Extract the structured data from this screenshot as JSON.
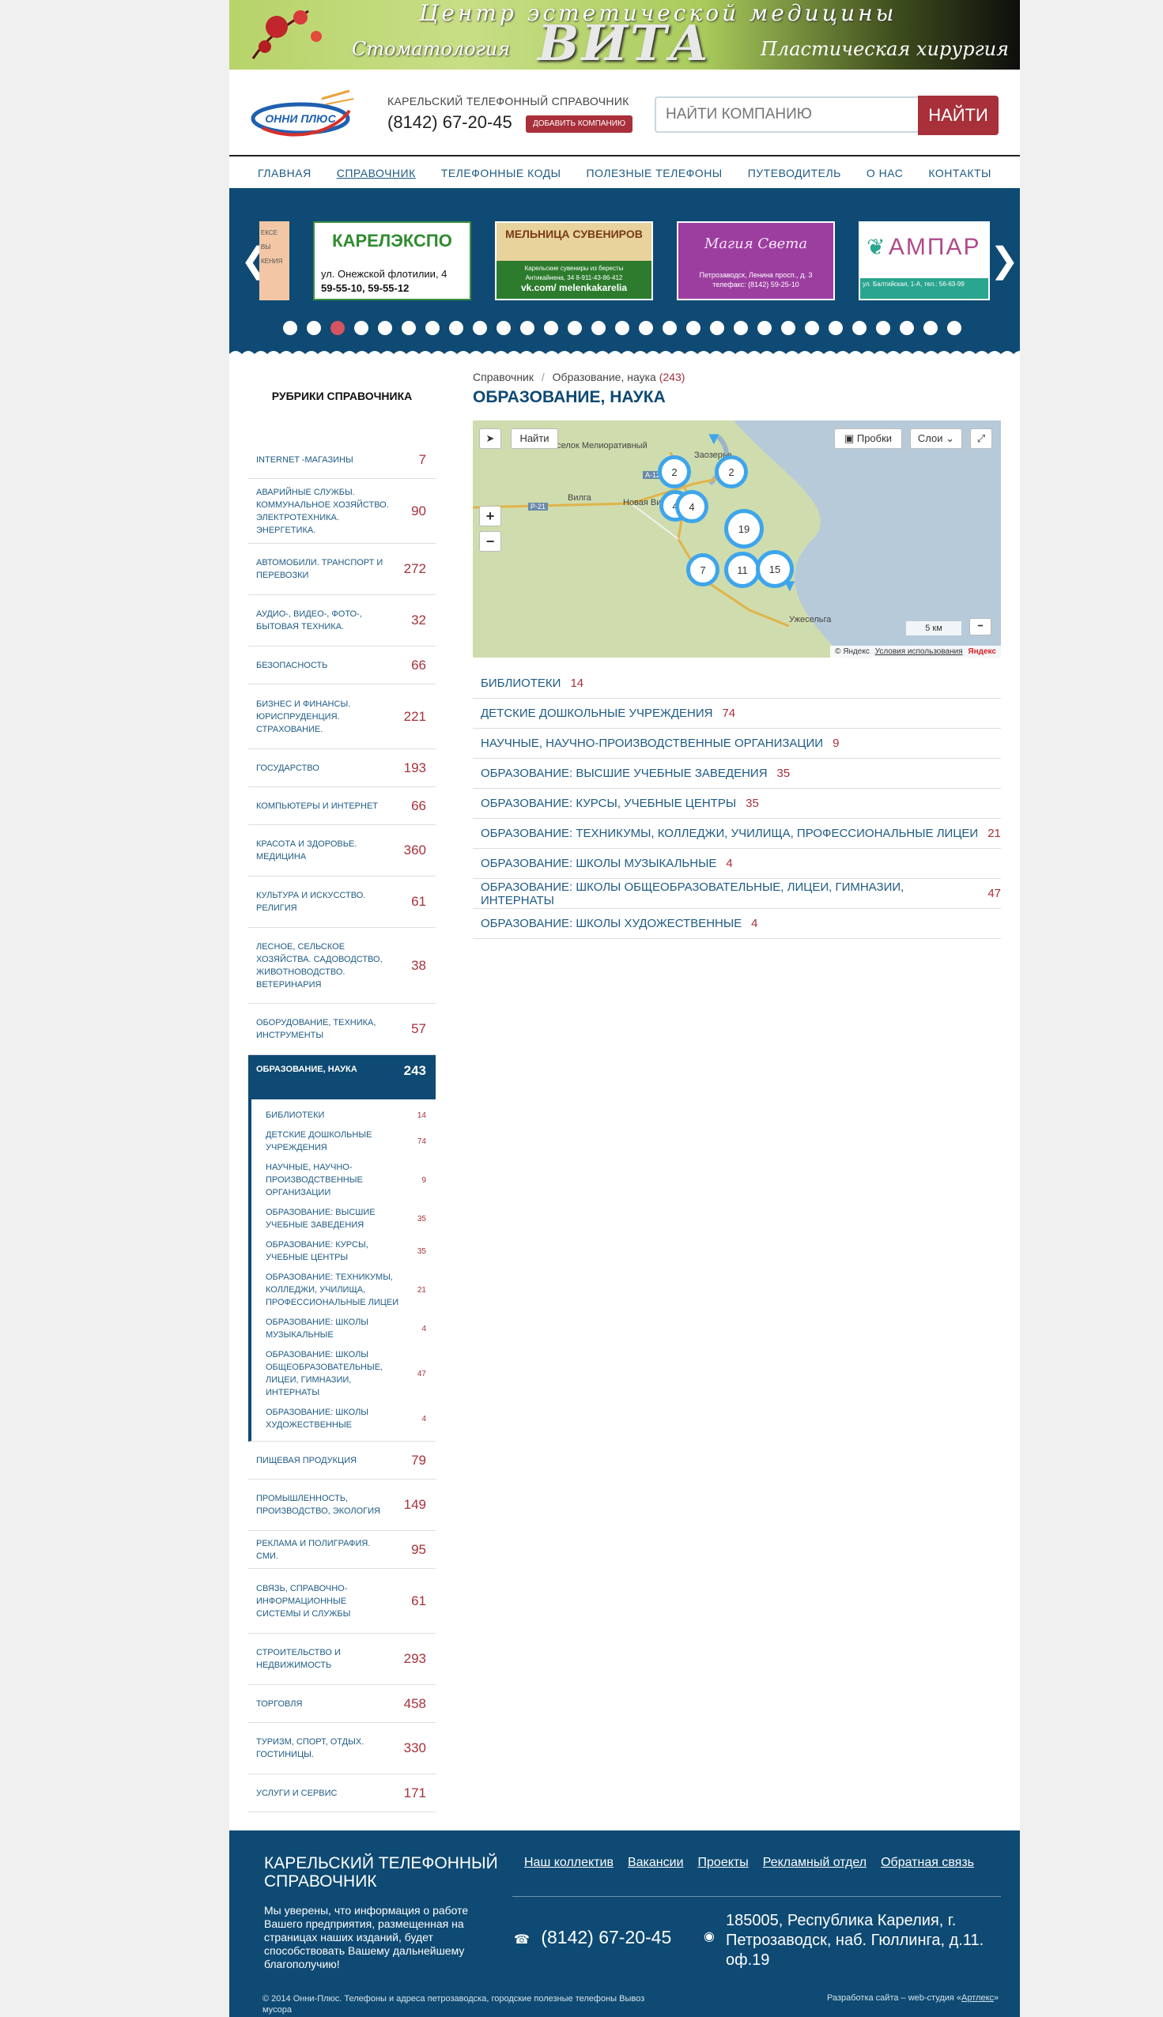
{
  "banner": {
    "title": "Центр эстетической медицины",
    "left": "Стоматология",
    "brand": "ВИТА",
    "right": "Пластическая хирургия"
  },
  "header": {
    "logo_text": "ОННИ ПЛЮС",
    "subtitle": "КАРЕЛЬСКИЙ ТЕЛЕФОННЫЙ СПРАВОЧНИК",
    "phone": "(8142) 67-20-45",
    "add_button": "ДОБАВИТЬ КОМПАНИЮ",
    "search_placeholder": "НАЙТИ КОМПАНИЮ",
    "search_button": "НАЙТИ"
  },
  "nav": [
    "ГЛАВНАЯ",
    "СПРАВОЧНИК",
    "ТЕЛЕФОННЫЕ КОДЫ",
    "ПОЛЕЗНЫЕ ТЕЛЕФОНЫ",
    "ПУТЕВОДИТЕЛЬ",
    "О НАС",
    "КОНТАКТЫ"
  ],
  "carousel": {
    "slides": [
      {
        "name": "partial-slide",
        "lines": [
          "ЕКСЕ",
          "ВЫ",
          "КЕНИЯ"
        ]
      },
      {
        "name": "karelexpo",
        "brand": "КАРЕЛЭКСПО",
        "lines": [
          "ул. Онежской флотилии, 4",
          "59-55-10, 59-55-12"
        ]
      },
      {
        "name": "melnitsa",
        "brand": "МЕЛЬНИЦА СУВЕНИРОВ",
        "lines": [
          "Карельские сувениры из бересты",
          "Антикайнена, 34  8-911-43-86-412",
          "vk.com/ melenkakarelia"
        ]
      },
      {
        "name": "magia-sveta",
        "brand": "Магия Света",
        "lines": [
          "Петрозаводск, Ленина просп., д. 3",
          "телефакс: (8142) 59-25-10"
        ]
      },
      {
        "name": "ampar",
        "brand": "АМПАР",
        "lines": [
          "ул. Балтийская, 1-А, тел.: 56-63-99"
        ]
      }
    ],
    "dots_count": 29,
    "active_dot": 3
  },
  "sidebar": {
    "title": "РУБРИКИ СПРАВОЧНИКА",
    "items_before": [
      {
        "label": "INTERNET -МАГАЗИНЫ",
        "count": "7"
      },
      {
        "label": "АВАРИЙНЫЕ СЛУЖБЫ. КОММУНАЛЬНОЕ ХОЗЯЙСТВО. ЭЛЕКТРОТЕХНИКА. ЭНЕРГЕТИКА.",
        "count": "90"
      },
      {
        "label": "АВТОМОБИЛИ. ТРАНСПОРТ И ПЕРЕВОЗКИ",
        "count": "272"
      },
      {
        "label": "АУДИО-, ВИДЕО-, ФОТО-, БЫТОВАЯ ТЕХНИКА.",
        "count": "32"
      },
      {
        "label": "БЕЗОПАСНОСТЬ",
        "count": "66"
      },
      {
        "label": "БИЗНЕС И ФИНАНСЫ. ЮРИСПРУДЕНЦИЯ. СТРАХОВАНИЕ.",
        "count": "221"
      },
      {
        "label": "ГОСУДАРСТВО",
        "count": "193"
      },
      {
        "label": "КОМПЬЮТЕРЫ И ИНТЕРНЕТ",
        "count": "66"
      },
      {
        "label": "КРАСОТА И ЗДОРОВЬЕ. МЕДИЦИНА",
        "count": "360"
      },
      {
        "label": "КУЛЬТУРА И ИСКУССТВО. РЕЛИГИЯ",
        "count": "61"
      },
      {
        "label": "ЛЕСНОЕ, СЕЛЬСКОЕ ХОЗЯЙСТВА. САДОВОДСТВО, ЖИВОТНОВОДСТВО. ВЕТЕРИНАРИЯ",
        "count": "38"
      },
      {
        "label": "ОБОРУДОВАНИЕ, ТЕХНИКА, ИНСТРУМЕНТЫ",
        "count": "57"
      }
    ],
    "active": {
      "label": "ОБРАЗОВАНИЕ, НАУКА",
      "count": "243"
    },
    "sub_items": [
      {
        "label": "БИБЛИОТЕКИ",
        "count": "14"
      },
      {
        "label": "ДЕТСКИЕ ДОШКОЛЬНЫЕ УЧРЕЖДЕНИЯ",
        "count": "74"
      },
      {
        "label": "НАУЧНЫЕ, НАУЧНО-ПРОИЗВОДСТВЕННЫЕ ОРГАНИЗАЦИИ",
        "count": "9"
      },
      {
        "label": "ОБРАЗОВАНИЕ: ВЫСШИЕ УЧЕБНЫЕ ЗАВЕДЕНИЯ",
        "count": "35"
      },
      {
        "label": "ОБРАЗОВАНИЕ: КУРСЫ, УЧЕБНЫЕ ЦЕНТРЫ",
        "count": "35"
      },
      {
        "label": "ОБРАЗОВАНИЕ: ТЕХНИКУМЫ, КОЛЛЕДЖИ, УЧИЛИЩА, ПРОФЕССИОНАЛЬНЫЕ ЛИЦЕИ",
        "count": "21"
      },
      {
        "label": "ОБРАЗОВАНИЕ: ШКОЛЫ МУЗЫКАЛЬНЫЕ",
        "count": "4"
      },
      {
        "label": "ОБРАЗОВАНИЕ: ШКОЛЫ ОБЩЕОБРАЗОВАТЕЛЬНЫЕ, ЛИЦЕИ, ГИМНАЗИИ, ИНТЕРНАТЫ",
        "count": "47"
      },
      {
        "label": "ОБРАЗОВАНИЕ: ШКОЛЫ ХУДОЖЕСТВЕННЫЕ",
        "count": "4"
      }
    ],
    "items_after": [
      {
        "label": "ПИЩЕВАЯ ПРОДУКЦИЯ",
        "count": "79"
      },
      {
        "label": "ПРОМЫШЛЕННОСТЬ, ПРОИЗВОДСТВО, ЭКОЛОГИЯ",
        "count": "149"
      },
      {
        "label": "РЕКЛАМА И ПОЛИГРАФИЯ. СМИ.",
        "count": "95"
      },
      {
        "label": "СВЯЗЬ, СПРАВОЧНО-ИНФОРМАЦИОННЫЕ СИСТЕМЫ И СЛУЖБЫ",
        "count": "61"
      },
      {
        "label": "СТРОИТЕЛЬСТВО И НЕДВИЖИМОСТЬ",
        "count": "293"
      },
      {
        "label": "ТОРГОВЛЯ",
        "count": "458"
      },
      {
        "label": "ТУРИЗМ, СПОРТ, ОТДЫХ. ГОСТИНИЦЫ.",
        "count": "330"
      },
      {
        "label": "УСЛУГИ И СЕРВИС",
        "count": "171"
      }
    ]
  },
  "main": {
    "breadcrumb_root": "Справочник",
    "breadcrumb_sep": "/",
    "breadcrumb_current": "Образование, наука",
    "breadcrumb_count": "(243)",
    "heading": "ОБРАЗОВАНИЕ, НАУКА",
    "map": {
      "find_button": "Найти",
      "traffic_button": "Пробки",
      "layers_button": "Слои",
      "scale": "5 км",
      "copyright": "© Яндекс",
      "terms": "Условия использования",
      "brand": "Яндекс",
      "labels": [
        "Заозерье",
        "поселок Мелиоративный",
        "Вилга",
        "Новая Вилга",
        "Ужесельга",
        "A-121",
        "P-21"
      ],
      "clusters": [
        "2",
        "2",
        "4",
        "4",
        "19",
        "7",
        "11",
        "15"
      ]
    },
    "categories": [
      {
        "label": "БИБЛИОТЕКИ",
        "count": "14"
      },
      {
        "label": "ДЕТСКИЕ ДОШКОЛЬНЫЕ УЧРЕЖДЕНИЯ",
        "count": "74"
      },
      {
        "label": "НАУЧНЫЕ, НАУЧНО-ПРОИЗВОДСТВЕННЫЕ ОРГАНИЗАЦИИ",
        "count": "9"
      },
      {
        "label": "ОБРАЗОВАНИЕ: ВЫСШИЕ УЧЕБНЫЕ ЗАВЕДЕНИЯ",
        "count": "35"
      },
      {
        "label": "ОБРАЗОВАНИЕ: КУРСЫ, УЧЕБНЫЕ ЦЕНТРЫ",
        "count": "35"
      },
      {
        "label": "ОБРАЗОВАНИЕ: ТЕХНИКУМЫ, КОЛЛЕДЖИ, УЧИЛИЩА, ПРОФЕССИОНАЛЬНЫЕ ЛИЦЕИ",
        "count": "21"
      },
      {
        "label": "ОБРАЗОВАНИЕ: ШКОЛЫ МУЗЫКАЛЬНЫЕ",
        "count": "4"
      },
      {
        "label": "ОБРАЗОВАНИЕ: ШКОЛЫ ОБЩЕОБРАЗОВАТЕЛЬНЫЕ, ЛИЦЕИ, ГИМНАЗИИ, ИНТЕРНАТЫ",
        "count": "47"
      },
      {
        "label": "ОБРАЗОВАНИЕ: ШКОЛЫ ХУДОЖЕСТВЕННЫЕ",
        "count": "4"
      }
    ]
  },
  "footer": {
    "title": "КАРЕЛЬСКИЙ ТЕЛЕФОННЫЙ СПРАВОЧНИК",
    "description": "Мы уверены, что информация о работе Вашего предприятия, размещенная на страницах наших изданий, будет способствовать Вашему дальнейшему благополучию!",
    "links": [
      "Наш коллектив",
      "Вакансии",
      "Проекты",
      "Рекламный отдел",
      "Обратная связь"
    ],
    "phone": "(8142) 67-20-45",
    "address": "185005, Республика Карелия, г. Петрозаводск, наб. Гюллинга, д.11. оф.19",
    "copyright": "© 2014 Онни-Плюс. Телефоны и адреса петрозаводска, городские полезные телефоны Вывоз мусора",
    "dev_prefix": "Разработка сайта – web-студия «",
    "dev_name": "Артлекс",
    "dev_suffix": "»"
  },
  "colors": {
    "primary": "#0e4a73",
    "accent": "#a7303a",
    "link": "#1e5b84",
    "cluster": "#3ea5eb"
  }
}
